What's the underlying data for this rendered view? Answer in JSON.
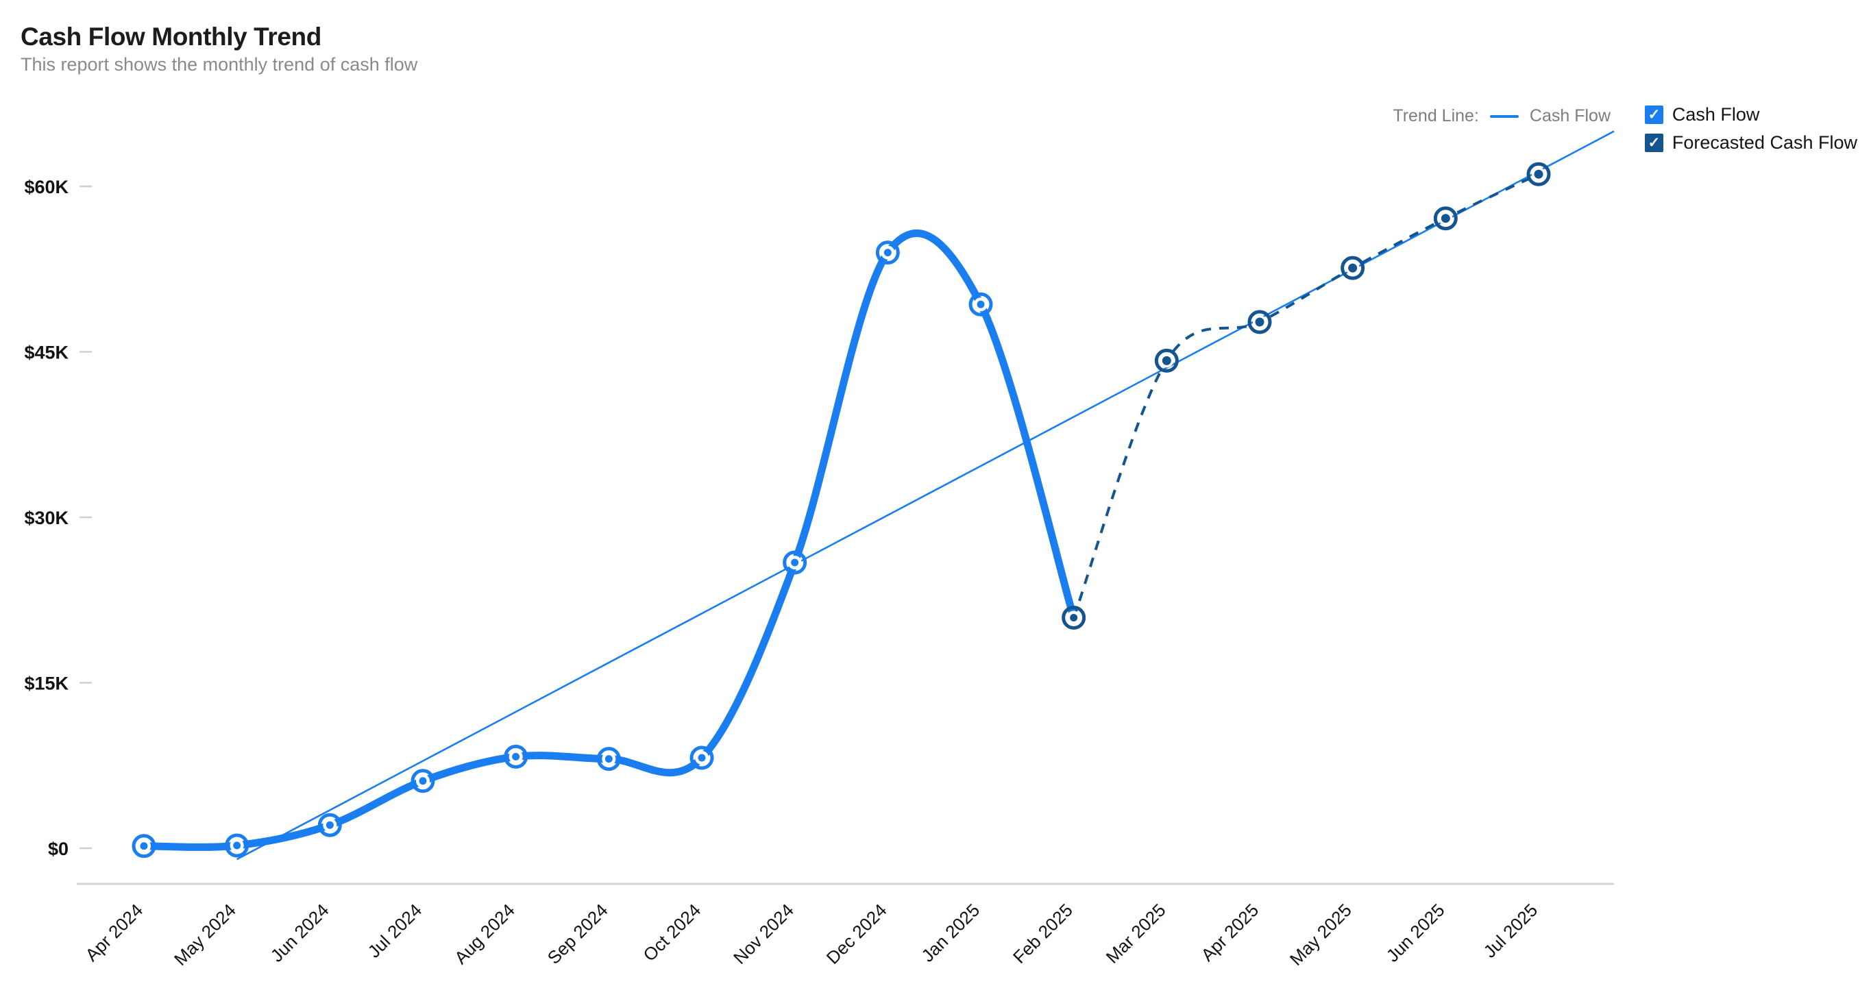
{
  "header": {
    "title": "Cash Flow Monthly Trend",
    "subtitle": "This report shows the monthly trend of cash flow"
  },
  "legend": {
    "trend_line_label": "Trend Line:",
    "trend_line_series": "Cash Flow",
    "items": [
      {
        "label": "Cash Flow",
        "color": "#1a7ef0",
        "checked": true,
        "check_glyph": "✓"
      },
      {
        "label": "Forecasted Cash Flow",
        "color": "#14548f",
        "checked": true,
        "check_glyph": "✓"
      }
    ]
  },
  "colors": {
    "actual": "#1a7ef0",
    "forecast": "#14548f",
    "trend": "#1a7ef0",
    "axis": "#d6d6d6",
    "title": "#1c1c1c",
    "subtitle": "#8a8a8a"
  },
  "chart_data": {
    "type": "line",
    "title": "Cash Flow Monthly Trend",
    "subtitle": "This report shows the monthly trend of cash flow",
    "xlabel": "",
    "ylabel": "",
    "categories": [
      "Apr 2024",
      "May 2024",
      "Jun 2024",
      "Jul 2024",
      "Aug 2024",
      "Sep 2024",
      "Oct 2024",
      "Nov 2024",
      "Dec 2024",
      "Jan 2025",
      "Feb 2025",
      "Mar 2025",
      "Apr 2025",
      "May 2025",
      "Jun 2025",
      "Jul 2025"
    ],
    "ytick_labels": [
      "$0",
      "$15K",
      "$30K",
      "$45K",
      "$60K"
    ],
    "ytick_values": [
      0,
      15000,
      30000,
      45000,
      60000
    ],
    "ylim": [
      0,
      66000
    ],
    "grid": false,
    "legend_position": "top-right",
    "series": [
      {
        "name": "Cash Flow",
        "color": "#1a7ef0",
        "style": "solid",
        "values": [
          200,
          250,
          2100,
          6100,
          8300,
          8100,
          8200,
          25900,
          54000,
          49300,
          20900,
          null,
          null,
          null,
          null,
          null
        ]
      },
      {
        "name": "Forecasted Cash Flow",
        "color": "#14548f",
        "style": "dashed",
        "values": [
          null,
          null,
          null,
          null,
          null,
          null,
          null,
          null,
          null,
          null,
          20900,
          44200,
          47700,
          52600,
          57100,
          61100
        ]
      },
      {
        "name": "Trend Line: Cash Flow",
        "color": "#1a7ef0",
        "style": "thin-solid",
        "type": "trend",
        "x_start": "May 2024",
        "x_end": "Jul 2025",
        "y_start": -1000,
        "y_end": 64500
      }
    ]
  }
}
